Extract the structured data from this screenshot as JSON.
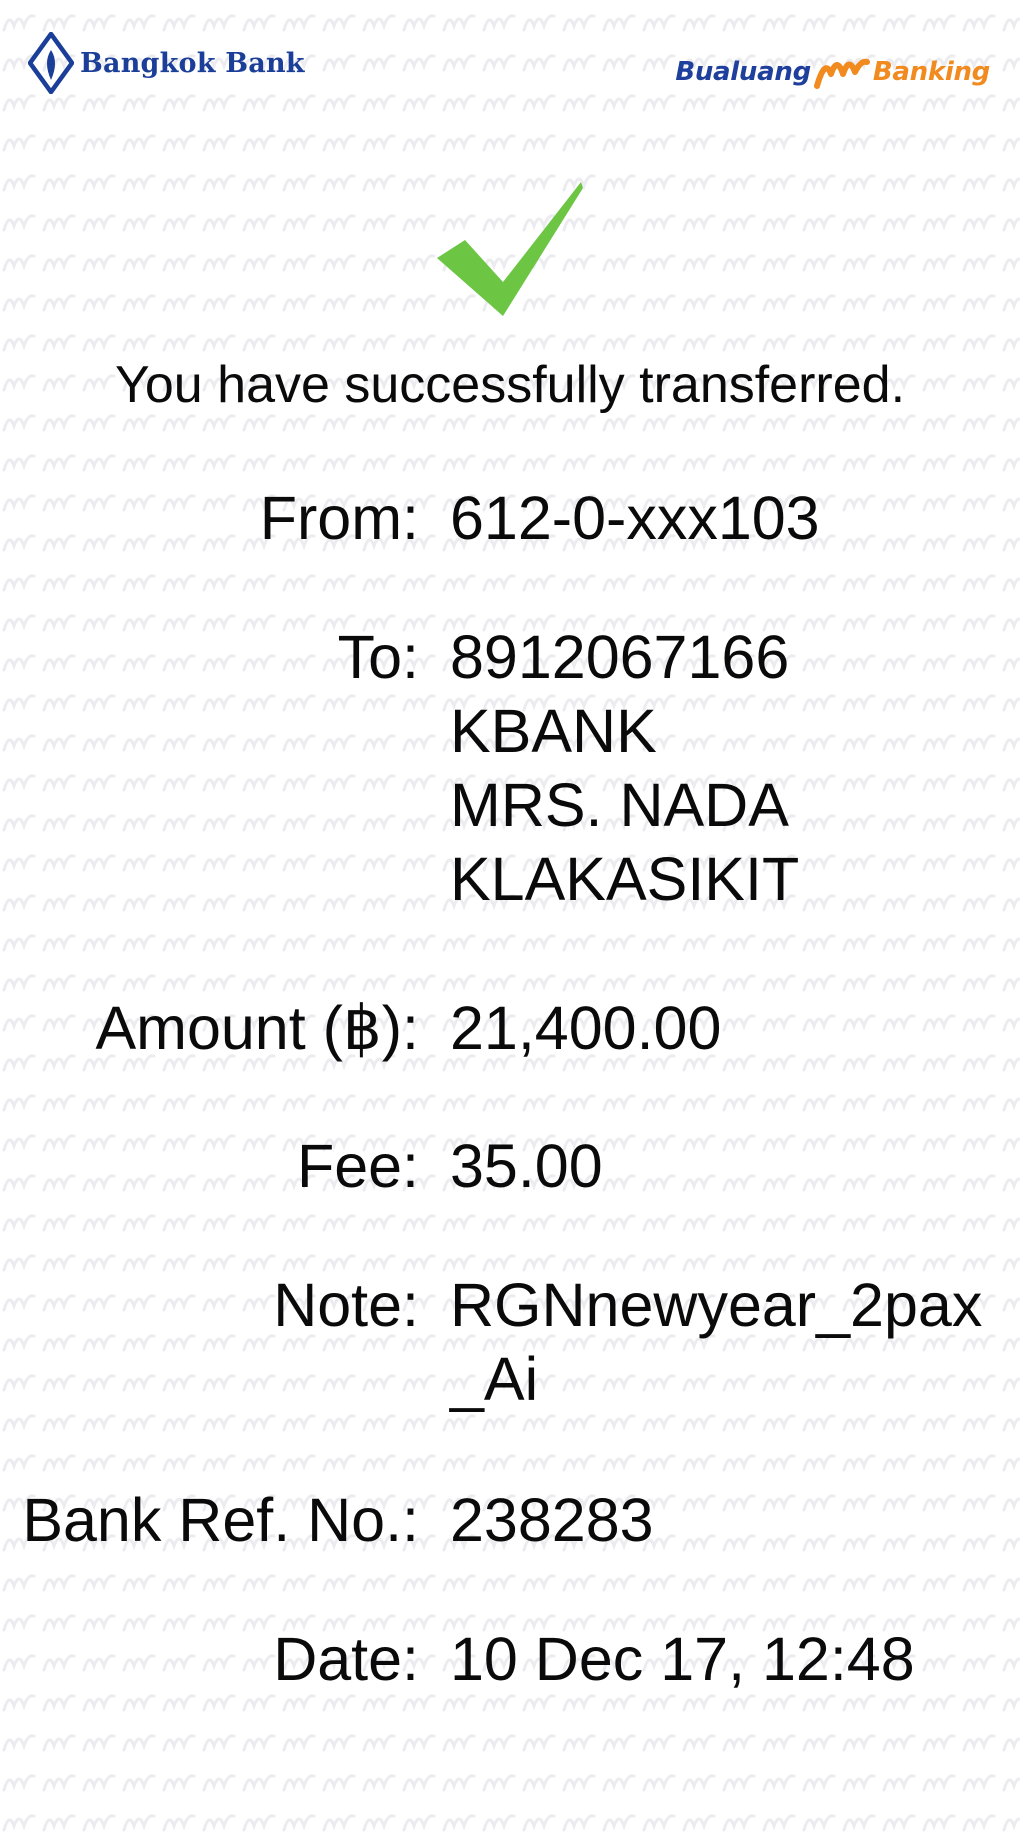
{
  "header": {
    "bank_name": "Bangkok Bank",
    "app_brand_left": "Bualuang",
    "app_brand_right": "Banking",
    "brand_colors": {
      "bank_blue": "#1b3f98",
      "app_orange": "#f18a1f"
    }
  },
  "status": {
    "icon": "checkmark-icon",
    "icon_color": "#6cc644",
    "message": "You have successfully transferred."
  },
  "transfer": {
    "from": {
      "label": "From:",
      "value": "612-0-xxx103"
    },
    "to": {
      "label": "To:",
      "lines": [
        "8912067166",
        "KBANK",
        "MRS. NADA",
        "KLAKASIKIT"
      ]
    },
    "amount": {
      "label": "Amount (฿):",
      "value": "21,400.00"
    },
    "fee": {
      "label": "Fee:",
      "value": "35.00"
    },
    "note": {
      "label": "Note:",
      "lines": [
        "RGNnewyear_2pax",
        "_Ai"
      ]
    },
    "bank_ref": {
      "label": "Bank Ref. No.:",
      "value": "238283"
    },
    "date": {
      "label": "Date:",
      "value": "10 Dec 17, 12:48"
    }
  }
}
